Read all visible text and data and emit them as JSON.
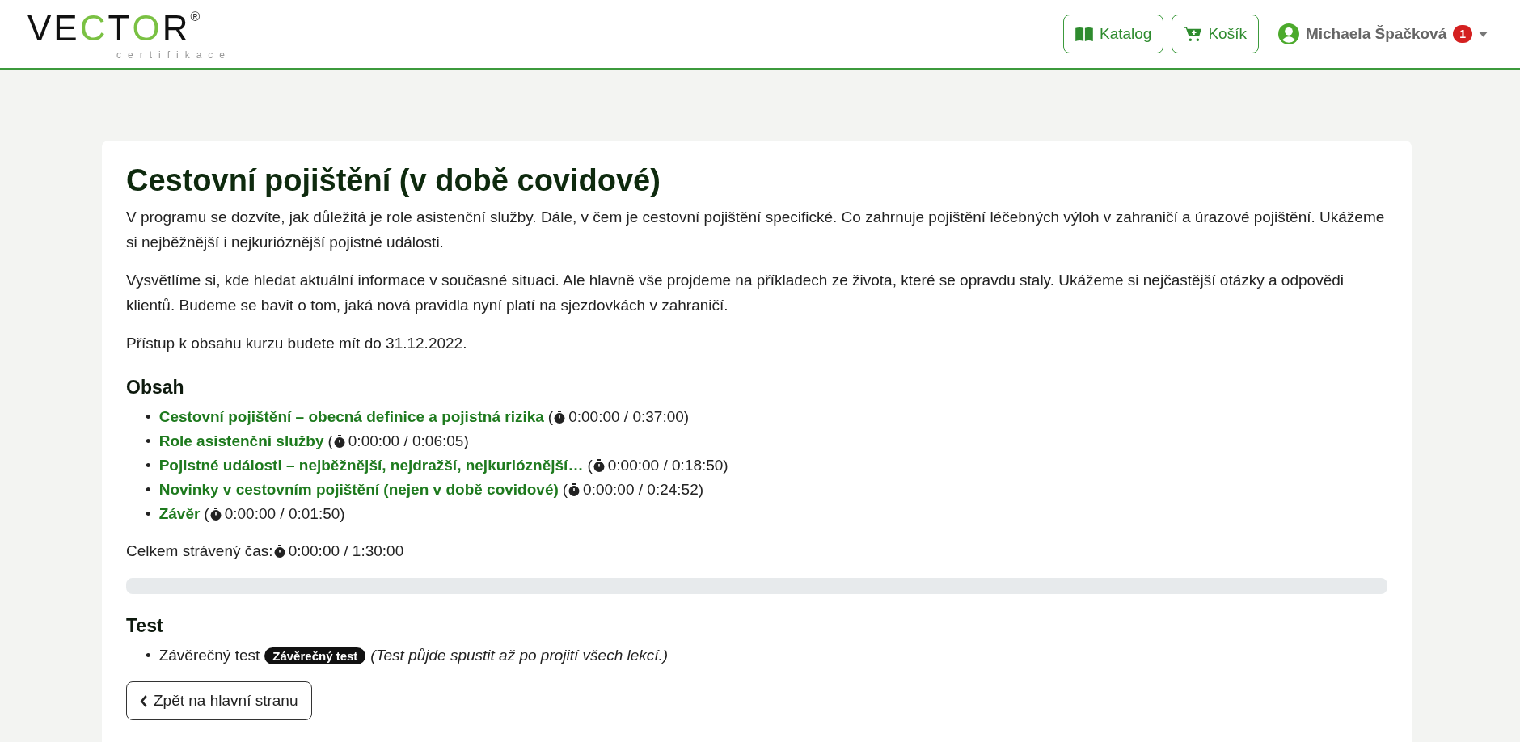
{
  "header": {
    "logo": {
      "letters": [
        "V",
        "E",
        "C",
        "T",
        "O",
        "R"
      ],
      "mark": "®",
      "tagline": "certifikace"
    },
    "buttons": [
      {
        "kind": "catalog",
        "label": "Katalog"
      },
      {
        "kind": "cart",
        "label": "Košík"
      }
    ],
    "user": {
      "name": "Michaela Špačková",
      "badge": "1"
    }
  },
  "course": {
    "title": "Cestovní pojištění (v době covidové)",
    "paragraphs": [
      "V programu se dozvíte, jak důležitá je role asistenční služby. Dále, v čem je cestovní pojištění specifické. Co zahrnuje pojištění léčebných výloh v zahraničí a úrazové pojištění. Ukážeme si nejběžnější i nejkurióznější pojistné události.",
      "Vysvětlíme si, kde hledat aktuální informace v současné situaci. Ale hlavně vše projdeme na příkladech ze života, které se opravdu staly. Ukážeme si nejčastější otázky a odpovědi klientů. Budeme se bavit o tom, jaká nová pravidla nyní platí na sjezdovkách v zahraničí.",
      "Přístup k obsahu kurzu budete mít do 31.12.2022."
    ],
    "contents_heading": "Obsah",
    "lessons": [
      {
        "bullet": "•",
        "title": "Cestovní pojištění – obecná definice a pojistná rizika",
        "open": "(",
        "time": "0:00:00 / 0:37:00)"
      },
      {
        "bullet": "•",
        "title": "Role asistenční služby",
        "open": "(",
        "time": "0:00:00 / 0:06:05)"
      },
      {
        "bullet": "•",
        "title": "Pojistné události – nejběžnější, nejdražší, nejkurióznější…",
        "open": "(",
        "time": "0:00:00 / 0:18:50)"
      },
      {
        "bullet": "•",
        "title": "Novinky v cestovním pojištění (nejen v době covidové)",
        "open": "(",
        "time": "0:00:00 / 0:24:52)"
      },
      {
        "bullet": "•",
        "title": "Závěr",
        "open": "(",
        "time": "0:00:00 / 0:01:50)"
      }
    ],
    "total_label": "Celkem strávený čas:",
    "total_time": "0:00:00 / 1:30:00",
    "progress": {
      "level": 0
    },
    "test_heading": "Test",
    "test": {
      "bullet": "•",
      "label": "Závěrečný test",
      "badge": "Závěrečný test",
      "note": "(Test půjde spustit až po projití všech lekcí.)"
    },
    "back_button": "Zpět na hlavní stranu"
  }
}
